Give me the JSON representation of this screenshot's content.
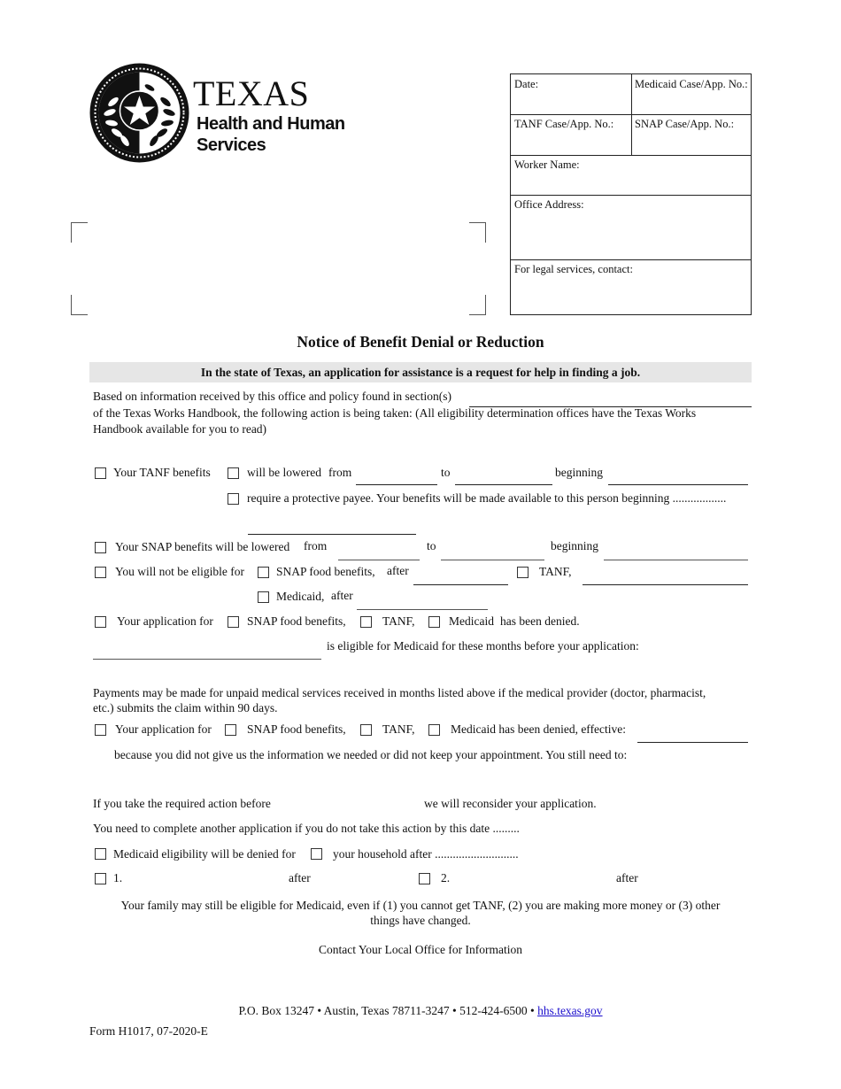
{
  "logo": {
    "icon": "texas-star-seal-icon",
    "line1": "TEXAS",
    "line2": "Health and Human",
    "line3": "Services"
  },
  "info_box": {
    "date_label": "Date:",
    "medicaid_case_label": "Medicaid Case/App. No.:",
    "tanf_case_label": "TANF Case/App. No.:",
    "snap_case_label": "SNAP Case/App. No.:",
    "worker_name_label": "Worker Name:",
    "office_address_label": "Office Address:",
    "legal_services_label": "For legal services, contact:"
  },
  "title": "Notice of Benefit Denial or Reduction",
  "banner": "In the state of Texas, an application for assistance is a request for help in finding a job.",
  "intro": {
    "line1": "Based on information received by this office and policy found in section(s)",
    "line2": "of the Texas Works Handbook, the following action is being taken: (All eligibility determination offices have the Texas Works",
    "line3": "Handbook available for you to read)"
  },
  "tanf_section": {
    "your_tanf_benefits": "Your TANF benefits",
    "will_be_lowered": "will be lowered",
    "from": "from",
    "to": "to",
    "beginning": "beginning",
    "protective_payee": "require a protective payee. Your benefits will be made available to this person beginning .................."
  },
  "snap_section": {
    "snap_lowered": "Your SNAP benefits will be lowered",
    "from": "from",
    "to": "to",
    "beginning": "beginning"
  },
  "not_eligible": {
    "label": "You will not be eligible for",
    "snap": "SNAP food benefits,",
    "after1": "after",
    "tanf": "TANF,",
    "medicaid": "Medicaid,",
    "after2": "after"
  },
  "app_denied": {
    "label": "Your application for",
    "snap": "SNAP food benefits,",
    "tanf": "TANF,",
    "medicaid": "Medicaid",
    "suffix": "has been denied."
  },
  "eligible_months": "is eligible for Medicaid for these months before your application:",
  "payments": {
    "line1": "Payments may be made for unpaid medical services received in months listed above if the medical provider (doctor, pharmacist,",
    "line2": "etc.) submits the claim within 90 days."
  },
  "app_denied_effective": {
    "label": "Your application for",
    "snap": "SNAP food benefits,",
    "tanf": "TANF,",
    "medicaid": "Medicaid has been denied, effective:",
    "because": "because you did not give us the information we needed or did not keep your appointment. You still need to:"
  },
  "reconsider": {
    "before": "If you take the required action before",
    "after": "we will reconsider your application."
  },
  "another_application": "You need to complete another application if you do not take this action by this date .........",
  "medicaid_denied": {
    "label": "Medicaid eligibility will be denied for",
    "household": "your household after ............................"
  },
  "persons": {
    "one": "1.",
    "after1": "after",
    "two": "2.",
    "after2": "after"
  },
  "family_note": {
    "line1": "Your family may still be eligible for Medicaid, even if (1) you cannot get TANF, (2) you are making more money or (3) other",
    "line2": "things have changed."
  },
  "contact": "Contact Your Local Office for Information",
  "footer": {
    "address": "P.O. Box 13247 • Austin, Texas 78711-3247 • 512-424-6500 • ",
    "website": "hhs.texas.gov",
    "form_id": "Form H1017, 07-2020-E"
  }
}
